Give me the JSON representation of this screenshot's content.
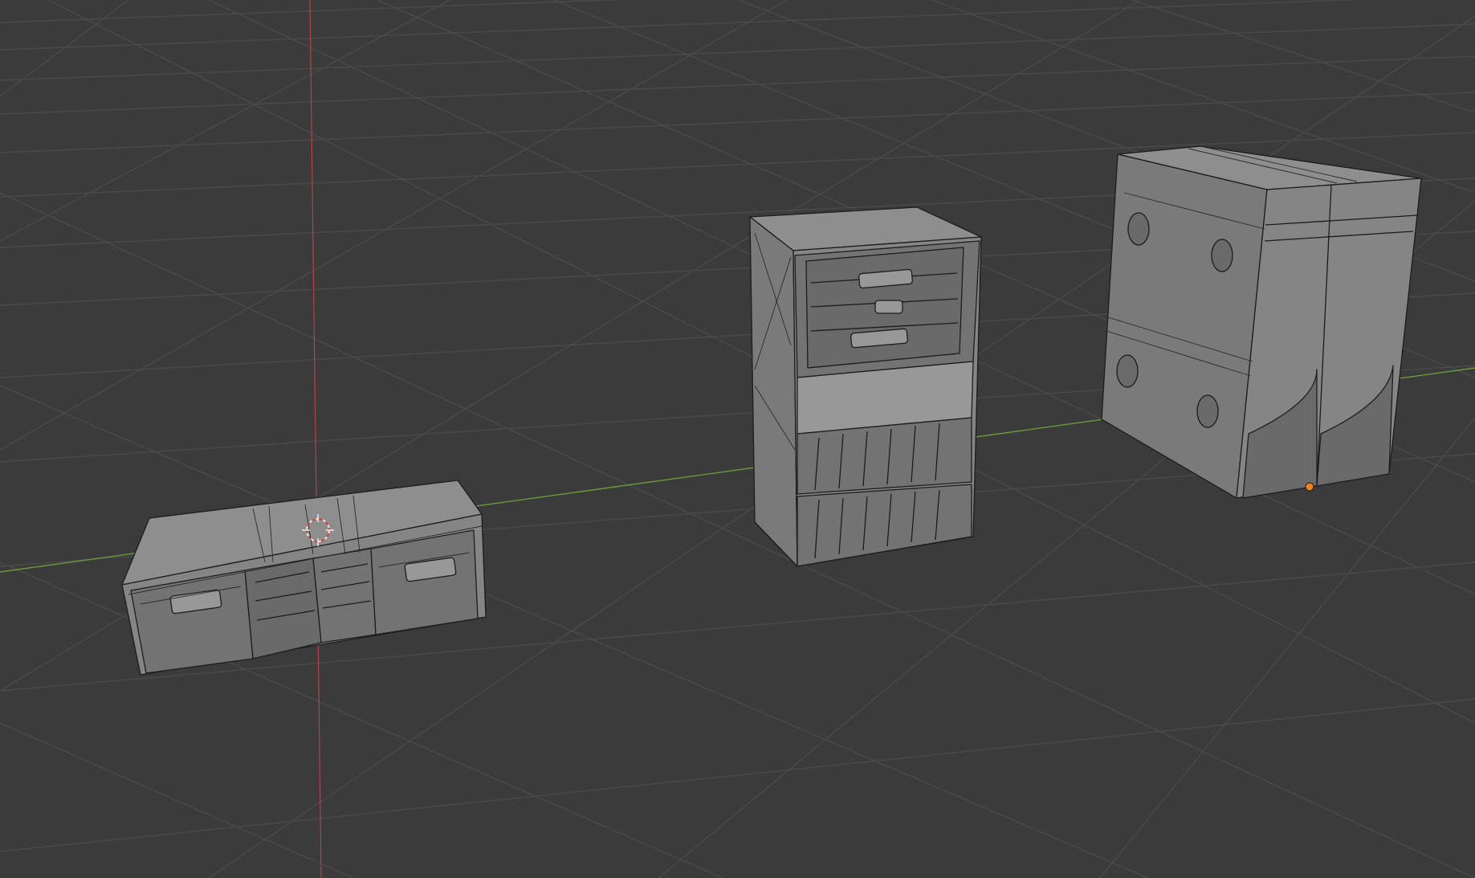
{
  "viewport": {
    "editor": "3d-viewport",
    "background_color": "#3b3b3b",
    "grid_color": "#4a4a4a",
    "x_axis_color": "#b3424a",
    "y_axis_color": "#6b9a3a",
    "selection_color": "#f0821e"
  },
  "scene": {
    "objects": [
      {
        "name_icon": "wide-cabinet-mesh",
        "shading": "solid-wireframe"
      },
      {
        "name_icon": "tall-cabinet-mesh",
        "shading": "solid-wireframe"
      },
      {
        "name_icon": "box-cabinet-mesh",
        "shading": "solid-wireframe"
      }
    ],
    "cursor_icon": "3d-cursor-icon",
    "origin_icon": "object-origin-icon"
  }
}
